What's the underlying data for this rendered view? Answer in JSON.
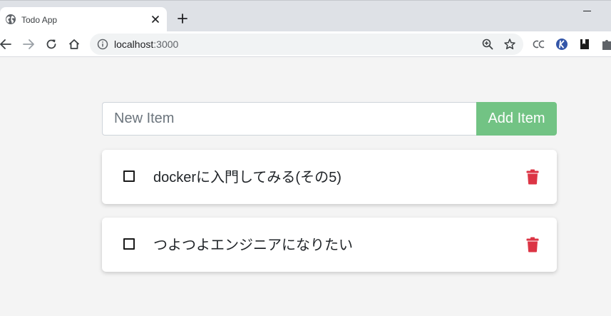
{
  "browser": {
    "tab": {
      "title": "Todo App"
    },
    "address": {
      "host": "localhost",
      "port_path": ":3000"
    }
  },
  "app": {
    "new_item": {
      "placeholder": "New Item",
      "value": ""
    },
    "add_button_label": "Add Item",
    "items": [
      {
        "name": "dockerに入門してみる(その5)",
        "completed": false
      },
      {
        "name": "つよつよエンジニアになりたい",
        "completed": false
      }
    ]
  },
  "colors": {
    "add_button": "#72c384",
    "delete_icon": "#dc3545",
    "page_background": "#f4f4f4"
  },
  "icons": {
    "favicon": "globe-icon",
    "delete": "trash-icon",
    "checkbox": "square-icon"
  }
}
